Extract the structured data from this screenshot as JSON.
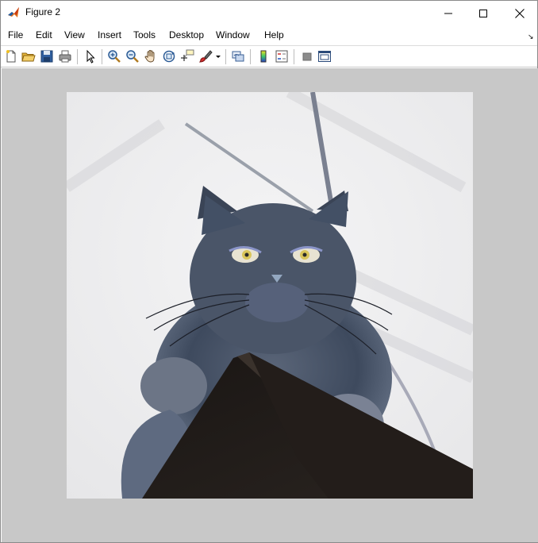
{
  "window": {
    "title": "Figure 2",
    "app_icon": "matlab-icon"
  },
  "window_controls": {
    "minimize_icon": "minimize-icon",
    "maximize_icon": "maximize-icon",
    "close_icon": "close-icon"
  },
  "menubar": {
    "items": [
      "File",
      "Edit",
      "View",
      "Insert",
      "Tools",
      "Desktop",
      "Window",
      "Help"
    ],
    "dock_icon": "dock-arrow-icon"
  },
  "toolbar": {
    "buttons": [
      "new-figure-icon",
      "open-file-icon",
      "save-icon",
      "print-icon",
      "edit-plot-icon",
      "zoom-in-icon",
      "zoom-out-icon",
      "pan-icon",
      "rotate-3d-icon",
      "data-cursor-icon",
      "brush-icon",
      "brush-dropdown-icon",
      "link-plot-icon",
      "insert-colorbar-icon",
      "insert-legend-icon",
      "hide-plot-tools-icon",
      "show-plot-tools-icon"
    ]
  },
  "figure": {
    "image_subject": "color-inverted photo of a long-haired cat peering over a dark pointed object",
    "background_color": "#c8c8c8"
  }
}
